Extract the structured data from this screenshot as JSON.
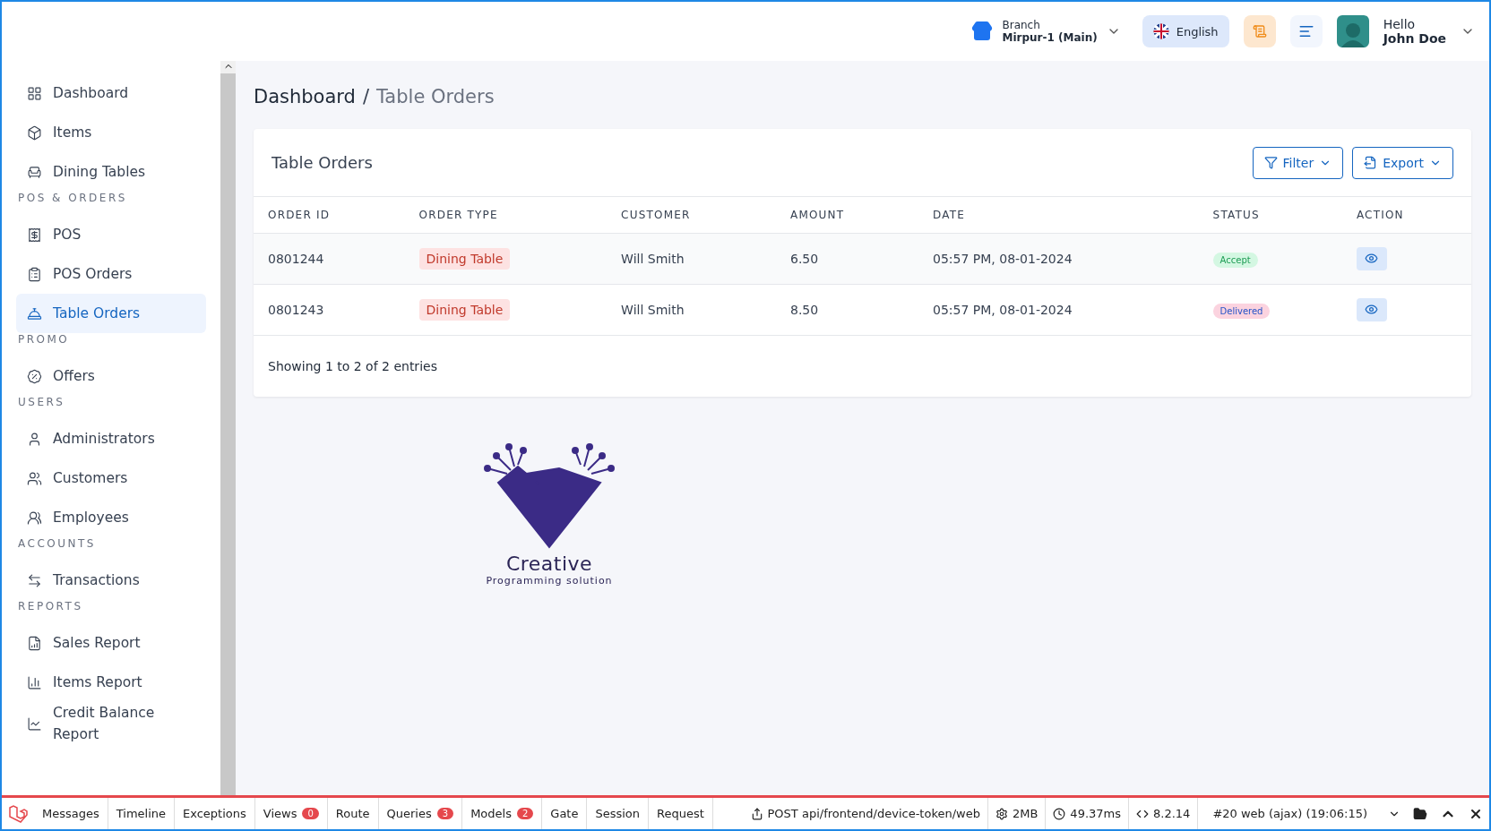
{
  "header": {
    "branch": {
      "label": "Branch",
      "value": "Mirpur-1 (Main)"
    },
    "language": "English",
    "user": {
      "greeting": "Hello",
      "name": "John Doe"
    }
  },
  "sidebar": {
    "items": [
      {
        "kind": "link",
        "label": "Dashboard",
        "selected": false
      },
      {
        "kind": "link",
        "label": "Items",
        "selected": false
      },
      {
        "kind": "link",
        "label": "Dining Tables",
        "selected": false
      },
      {
        "kind": "section",
        "label": "POS & ORDERS"
      },
      {
        "kind": "link",
        "label": "POS",
        "selected": false
      },
      {
        "kind": "link",
        "label": "POS Orders",
        "selected": false
      },
      {
        "kind": "link",
        "label": "Table Orders",
        "selected": true
      },
      {
        "kind": "section",
        "label": "PROMO"
      },
      {
        "kind": "link",
        "label": "Offers",
        "selected": false
      },
      {
        "kind": "section",
        "label": "USERS"
      },
      {
        "kind": "link",
        "label": "Administrators",
        "selected": false
      },
      {
        "kind": "link",
        "label": "Customers",
        "selected": false
      },
      {
        "kind": "link",
        "label": "Employees",
        "selected": false
      },
      {
        "kind": "section",
        "label": "ACCOUNTS"
      },
      {
        "kind": "link",
        "label": "Transactions",
        "selected": false
      },
      {
        "kind": "section",
        "label": "REPORTS"
      },
      {
        "kind": "link",
        "label": "Sales Report",
        "selected": false
      },
      {
        "kind": "link",
        "label": "Items Report",
        "selected": false
      },
      {
        "kind": "link",
        "label": "Credit Balance Report",
        "selected": false
      }
    ]
  },
  "breadcrumb": {
    "root": "Dashboard",
    "separator": "/",
    "current": "Table Orders"
  },
  "card": {
    "title": "Table Orders",
    "buttons": [
      "Filter",
      "Export"
    ],
    "table": {
      "columns": [
        "ORDER ID",
        "ORDER TYPE",
        "CUSTOMER",
        "AMOUNT",
        "DATE",
        "STATUS",
        "ACTION"
      ],
      "rows": [
        {
          "order_id": "0801244",
          "order_type": "Dining Table",
          "customer": "Will Smith",
          "amount": "6.50",
          "date": "05:57 PM, 08-01-2024",
          "status": {
            "kind": "accept",
            "text": "Accept",
            "color": "#d4f7e2"
          }
        },
        {
          "order_id": "0801243",
          "order_type": "Dining Table",
          "customer": "Will Smith",
          "amount": "8.50",
          "date": "05:57 PM, 08-01-2024",
          "status": {
            "kind": "delivered",
            "text": "Delivered",
            "color": "#fbd3df"
          }
        }
      ]
    },
    "footer": "Showing 1 to 2 of 2 entries"
  },
  "logo": {
    "title": "Creative",
    "subtitle": "Programming solution"
  },
  "debugbar": {
    "tabs": [
      {
        "label": "Messages"
      },
      {
        "label": "Timeline"
      },
      {
        "label": "Exceptions"
      },
      {
        "label": "Views",
        "count": "0"
      },
      {
        "label": "Route"
      },
      {
        "label": "Queries",
        "count": "3"
      },
      {
        "label": "Models",
        "count": "2"
      },
      {
        "label": "Gate"
      },
      {
        "label": "Session"
      },
      {
        "label": "Request"
      }
    ],
    "request": "POST api/frontend/device-token/web",
    "memory": "2MB",
    "time": "49.37ms",
    "php": "8.2.14",
    "dataset": "#20 web (ajax) (19:06:15)"
  }
}
